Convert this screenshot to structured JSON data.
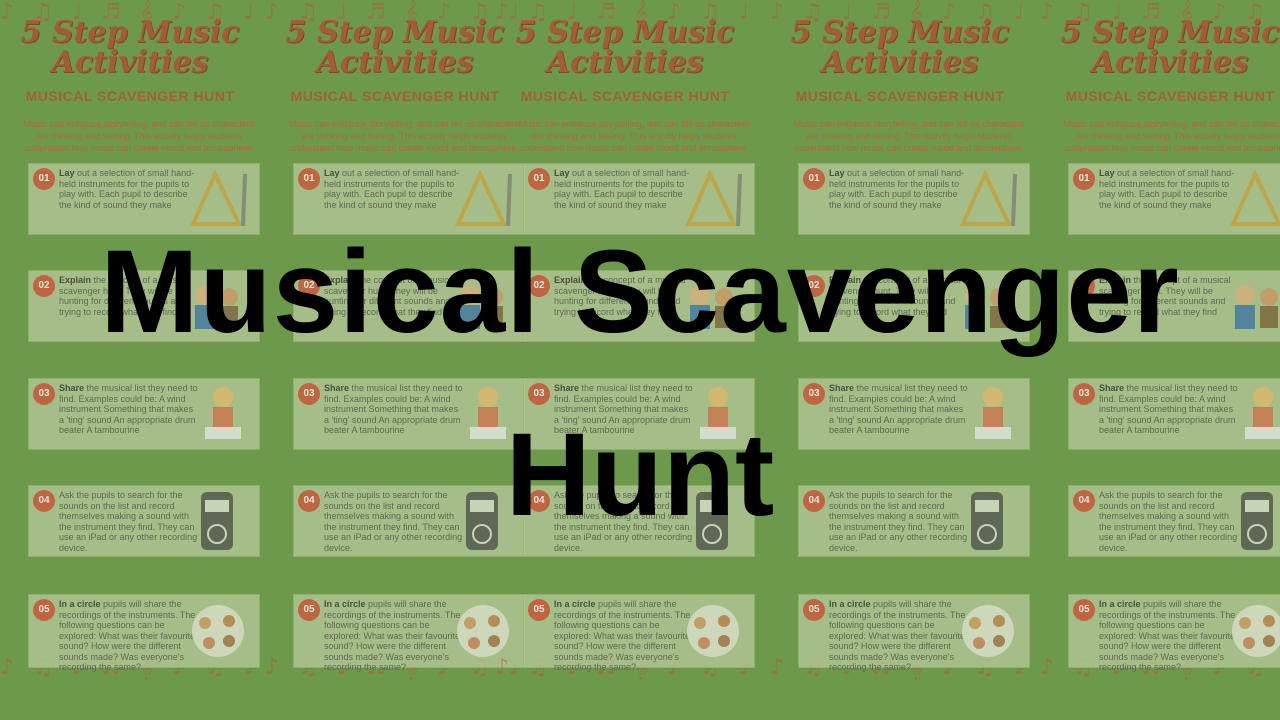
{
  "poster": {
    "title": "5 Step Music Activities",
    "subtitle": "MUSICAL SCAVENGER HUNT",
    "intro": "Music can enhance storytelling, and can tell us characters are thinking and feeling. This activity helps students understand how music can create mood and atmosphere.",
    "steps": [
      {
        "num": "01",
        "bold": "Lay",
        "text": " out a selection of small hand-held instruments for the pupils to play with. Each pupil to describe the kind of sound they make",
        "icon": "triangle-icon"
      },
      {
        "num": "02",
        "bold": "Explain",
        "text": " the concept of a musical scavenger hunt. They will be hunting for different sounds and trying to record what they find",
        "icon": "children-icon"
      },
      {
        "num": "03",
        "bold": "Share",
        "text": " the musical list they need to find. Examples could be: A wind instrument Something that makes a 'ting' sound An appropriate drum beater A tambourine",
        "icon": "teacher-icon"
      },
      {
        "num": "04",
        "bold": "search",
        "text": "Ask the pupils to search for the sounds on the list and record themselves making a sound with the instrument they find. They can use an iPad or any other recording device.",
        "icon": "recorder-icon"
      },
      {
        "num": "05",
        "bold": "In a circle",
        "text": " pupils will share the recordings of the instruments. The following questions can be explored: What was their favourite sound? How were the different sounds made? Was everyone's recording the same?",
        "icon": "circle-group-icon"
      }
    ]
  },
  "headline": {
    "line1": "Musical Scavenger",
    "line2": "Hunt"
  },
  "colors": {
    "background": "#6d9a4a",
    "accent": "#d9553f",
    "card": "#b7c99a",
    "headline": "#000000"
  }
}
